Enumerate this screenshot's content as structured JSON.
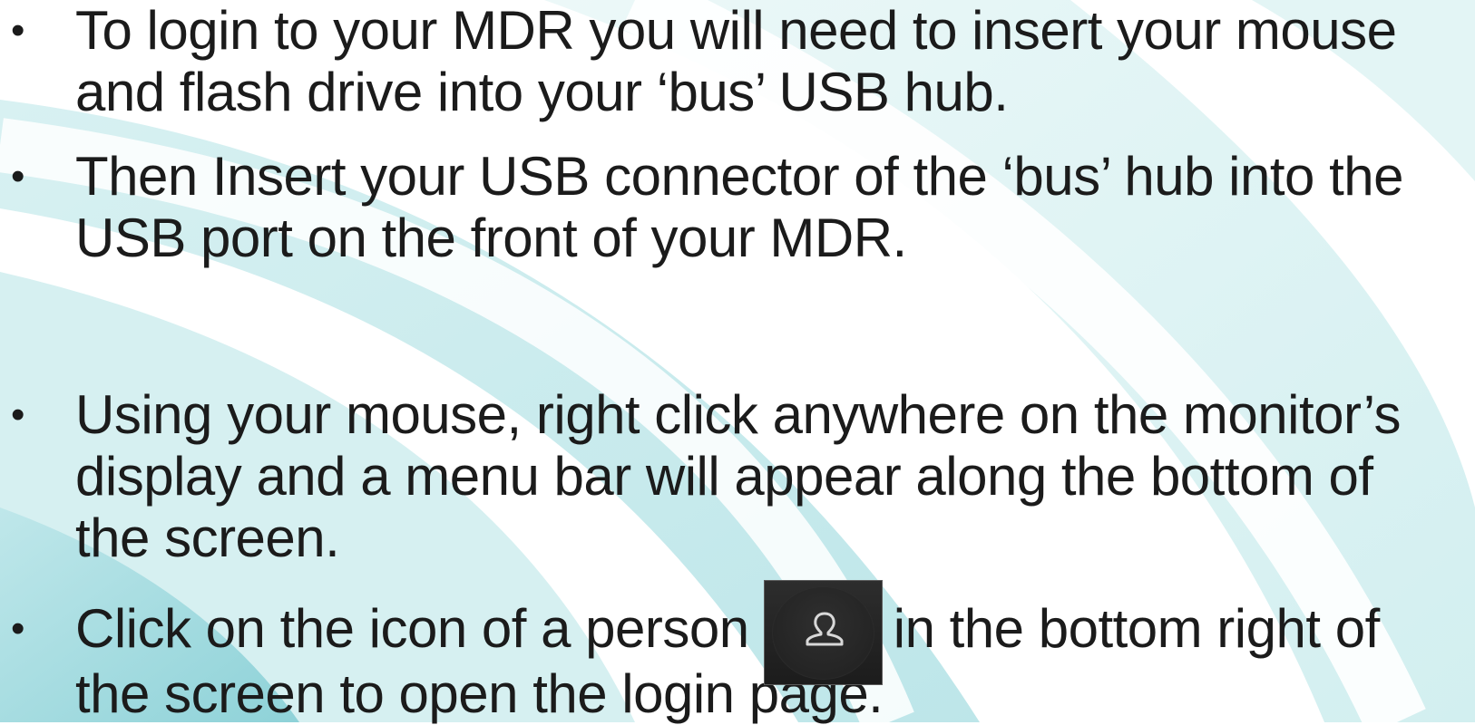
{
  "bullets": [
    {
      "marker": "•",
      "text": "To login to your MDR you will need to insert your mouse\nand flash drive into your ‘bus’ USB hub."
    },
    {
      "marker": "•",
      "text": "Then Insert your USB connector of the ‘bus’ hub into the\nUSB port on the front of your MDR."
    },
    {
      "marker": "•",
      "text": "Using your mouse, right click anywhere on the monitor’s\ndisplay and a menu bar will appear along the bottom of\nthe screen."
    },
    {
      "marker": "•",
      "text_before_icon": "Click on the icon of a person ",
      "text_after_icon": "in the bottom right of\nthe screen to open the login page.",
      "icon": "person-icon"
    }
  ],
  "colors": {
    "text": "#1b1b1b",
    "arc_light": "#d9f1f2",
    "arc_mid": "#c2e9ec",
    "arc_dark": "#8fd4d9",
    "icon_bg": "#262626",
    "icon_stroke": "#d8d8d8"
  }
}
